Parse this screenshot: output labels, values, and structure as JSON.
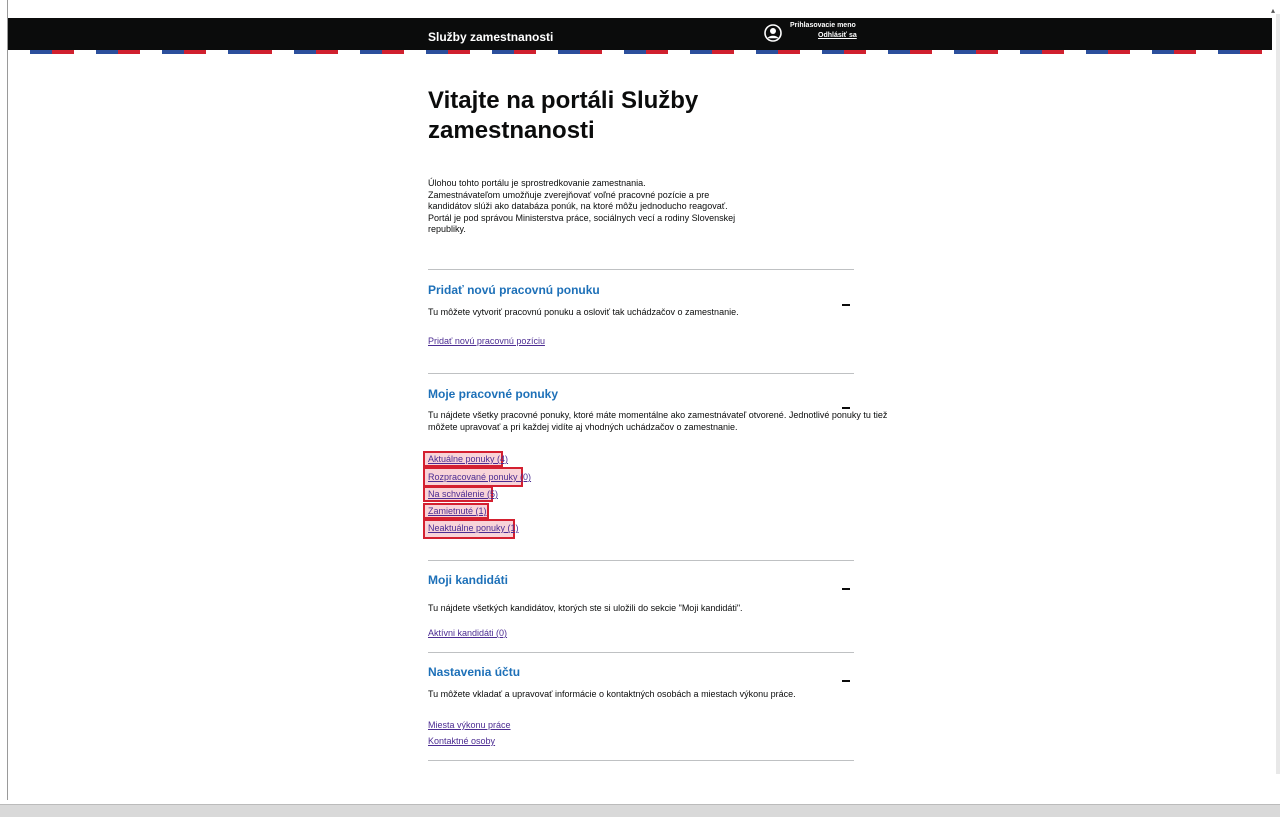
{
  "header": {
    "brand": "Služby zamestnanosti",
    "user_label": "Prihlasovacie meno",
    "logout_label": "Odhlásiť sa"
  },
  "page": {
    "title_line1": "Vitajte na portáli Služby",
    "title_line2": "zamestnanosti",
    "intro_lines": [
      "Úlohou tohto portálu je sprostredkovanie zamestnania.",
      "Zamestnávateľom umožňuje zverejňovať voľné pracovné pozície a pre",
      "kandidátov slúži ako databáza ponúk, na ktoré môžu jednoducho reagovať.",
      "Portál je pod správou Ministerstva práce, sociálnych vecí a rodiny Slovenskej",
      "republiky."
    ]
  },
  "sections": [
    {
      "title": "Pridať novú pracovnú ponuku",
      "description": "Tu môžete vytvoriť pracovnú ponuku a osloviť tak uchádzačov o zamestnanie.",
      "links": [
        "Pridať novú pracovnú pozíciu"
      ]
    },
    {
      "title": "Moje pracovné ponuky",
      "description_line1": "Tu nájdete všetky pracovné ponuky, ktoré máte momentálne ako zamestnávateľ otvorené. Jednotlivé ponuky tu tiež",
      "description_line2": "môžete upravovať a pri každej vidíte aj vhodných uchádzačov o zamestnanie.",
      "links": [
        "Aktuálne ponuky (4)",
        "Rozpracované ponuky (0)",
        "Na schválenie (5)",
        "Zamietnuté (1)",
        "Neaktuálne ponuky (1)"
      ]
    },
    {
      "title": "Moji kandidáti",
      "description": "Tu nájdete všetkých kandidátov, ktorých ste si uložili do sekcie \"Moji kandidáti\".",
      "links": [
        "Aktívni kandidáti (0)"
      ]
    },
    {
      "title": "Nastavenia účtu",
      "description": "Tu môžete vkladať a upravovať informácie o kontaktných osobách a miestach výkonu práce.",
      "links": [
        "Miesta výkonu práce",
        "Kontaktné osoby"
      ]
    }
  ],
  "colors": {
    "header_bg": "#0b0c0c",
    "section_title": "#1d70b8",
    "link": "#4c2c92",
    "highlight_border": "#d42030"
  }
}
